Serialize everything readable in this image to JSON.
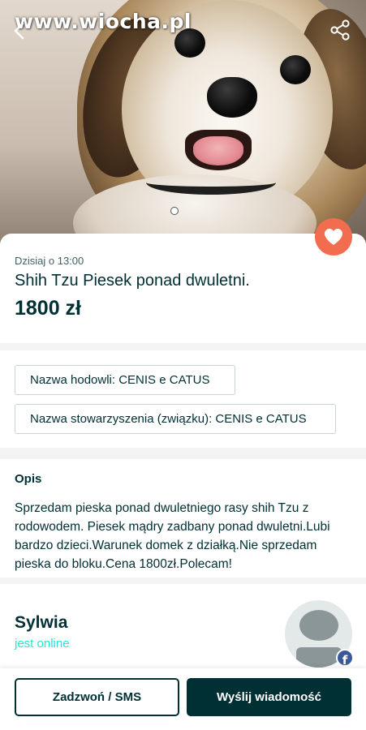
{
  "watermark": "www.wiocha.pl",
  "hero": {
    "image_description": "",
    "slide_count": 1,
    "active_slide": 1
  },
  "listing": {
    "date": "Dzisiaj o 13:00",
    "title": "Shih Tzu Piesek ponad dwuletni.",
    "price": "1800 zł"
  },
  "params": [
    {
      "label": "Nazwa hodowli: CENIS e CATUS"
    },
    {
      "label": "Nazwa stowarzyszenia (związku): CENIS e CATUS"
    }
  ],
  "description": {
    "heading": "Opis",
    "text": "Sprzedam pieska ponad dwuletniego rasy shih Tzu z rodowodem. Piesek mądry zadbany ponad dwuletni.Lubi bardzo dzieci.Warunek domek z działką.Nie sprzedam pieska do bloku.Cena 1800zł.Polecam!"
  },
  "seller": {
    "name": "Sylwia",
    "status": "jest online",
    "badge": "f"
  },
  "actions": {
    "call_label": "Zadzwoń / SMS",
    "message_label": "Wyślij wiadomość"
  },
  "colors": {
    "primary": "#002f34",
    "accent_online": "#23e5db",
    "favorite": "#f26d4f",
    "facebook": "#3b5998"
  },
  "icons": {
    "back": "chevron-left-icon",
    "share": "share-icon",
    "favorite": "heart-icon"
  }
}
